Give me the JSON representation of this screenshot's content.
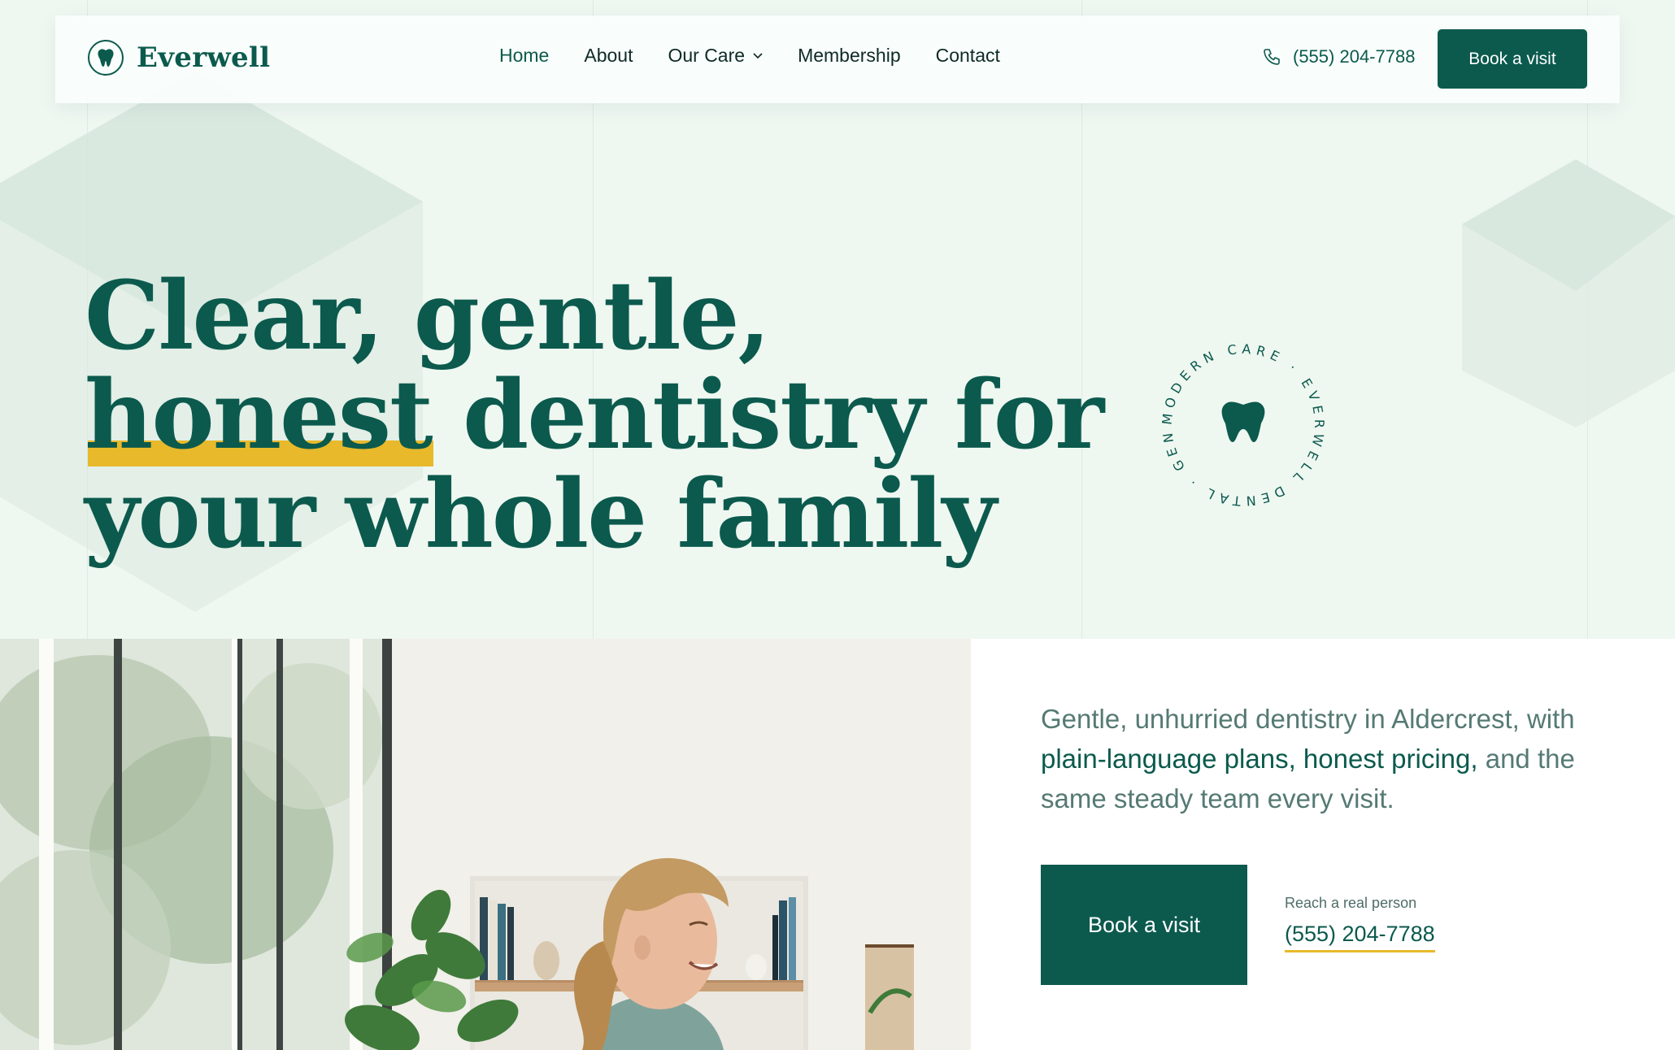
{
  "brand": {
    "name": "Everwell"
  },
  "nav": {
    "items": [
      {
        "label": "Home",
        "active": true
      },
      {
        "label": "About"
      },
      {
        "label": "Our Care",
        "dropdown": true
      },
      {
        "label": "Membership"
      },
      {
        "label": "Contact"
      }
    ],
    "phone": "(555) 204-7788",
    "cta_label": "Book a visit"
  },
  "hero": {
    "headline_line1": "Clear, gentle,",
    "headline_highlight": "honest",
    "headline_line2_rest": " dentistry for",
    "headline_line3": "your whole family",
    "badge_text": "MODERN CARE · EVERWELL DENTAL · GENTLE ·"
  },
  "intro": {
    "lede_start": "Gentle, unhurried dentistry in Aldercrest, with ",
    "lede_emphasis": "plain-language plans, honest pricing,",
    "lede_end": " and the same steady team every visit."
  },
  "cta": {
    "book_label": "Book a visit",
    "reach_label": "Reach a real person",
    "reach_phone": "(555) 204-7788"
  },
  "colors": {
    "brand_green": "#0b5a4d",
    "accent_yellow": "#e8b92b",
    "hero_bg": "#eff7f1"
  }
}
